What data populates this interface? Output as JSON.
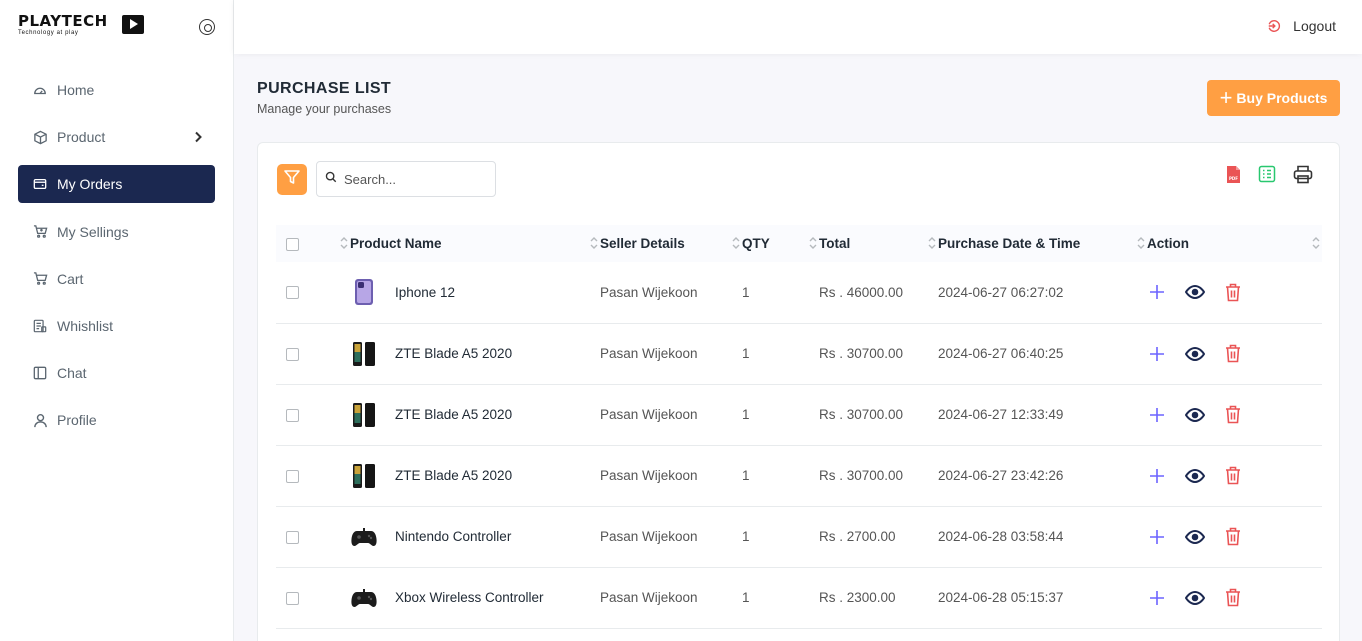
{
  "brand": {
    "name": "PLAYTECH",
    "tagline": "Technology at play"
  },
  "sidebar": {
    "items": [
      {
        "label": "Home",
        "icon": "dashboard-icon",
        "active": false
      },
      {
        "label": "Product",
        "icon": "box-icon",
        "active": false,
        "has_submenu": true
      },
      {
        "label": "My Orders",
        "icon": "wallet-icon",
        "active": true
      },
      {
        "label": "My Sellings",
        "icon": "cart-plus-icon",
        "active": false
      },
      {
        "label": "Cart",
        "icon": "cart-icon",
        "active": false
      },
      {
        "label": "Whishlist",
        "icon": "list-icon",
        "active": false
      },
      {
        "label": "Chat",
        "icon": "chat-icon",
        "active": false
      },
      {
        "label": "Profile",
        "icon": "user-icon",
        "active": false
      }
    ]
  },
  "header": {
    "logout_label": "Logout"
  },
  "page": {
    "title": "PURCHASE LIST",
    "subtitle": "Manage your purchases",
    "buy_button_label": "Buy Products"
  },
  "search": {
    "placeholder": "Search..."
  },
  "table": {
    "headers": [
      "Product Name",
      "Seller Details",
      "QTY",
      "Total",
      "Purchase Date & Time",
      "Action"
    ],
    "rows": [
      {
        "product": "Iphone 12",
        "thumb": "phone-purple",
        "seller": "Pasan Wijekoon",
        "qty": "1",
        "total": "Rs . 46000.00",
        "datetime": "2024-06-27 06:27:02"
      },
      {
        "product": "ZTE Blade A5 2020",
        "thumb": "phone-black",
        "seller": "Pasan Wijekoon",
        "qty": "1",
        "total": "Rs . 30700.00",
        "datetime": "2024-06-27 06:40:25"
      },
      {
        "product": "ZTE Blade A5 2020",
        "thumb": "phone-black",
        "seller": "Pasan Wijekoon",
        "qty": "1",
        "total": "Rs . 30700.00",
        "datetime": "2024-06-27 12:33:49"
      },
      {
        "product": "ZTE Blade A5 2020",
        "thumb": "phone-black",
        "seller": "Pasan Wijekoon",
        "qty": "1",
        "total": "Rs . 30700.00",
        "datetime": "2024-06-27 23:42:26"
      },
      {
        "product": "Nintendo Controller",
        "thumb": "gamepad",
        "seller": "Pasan Wijekoon",
        "qty": "1",
        "total": "Rs . 2700.00",
        "datetime": "2024-06-28 03:58:44"
      },
      {
        "product": "Xbox Wireless Controller",
        "thumb": "gamepad",
        "seller": "Pasan Wijekoon",
        "qty": "1",
        "total": "Rs . 2300.00",
        "datetime": "2024-06-28 05:15:37"
      }
    ]
  },
  "colors": {
    "accent": "#ff9f43",
    "nav_active": "#1b2850",
    "add": "#6c63ff",
    "delete": "#ea5455"
  }
}
